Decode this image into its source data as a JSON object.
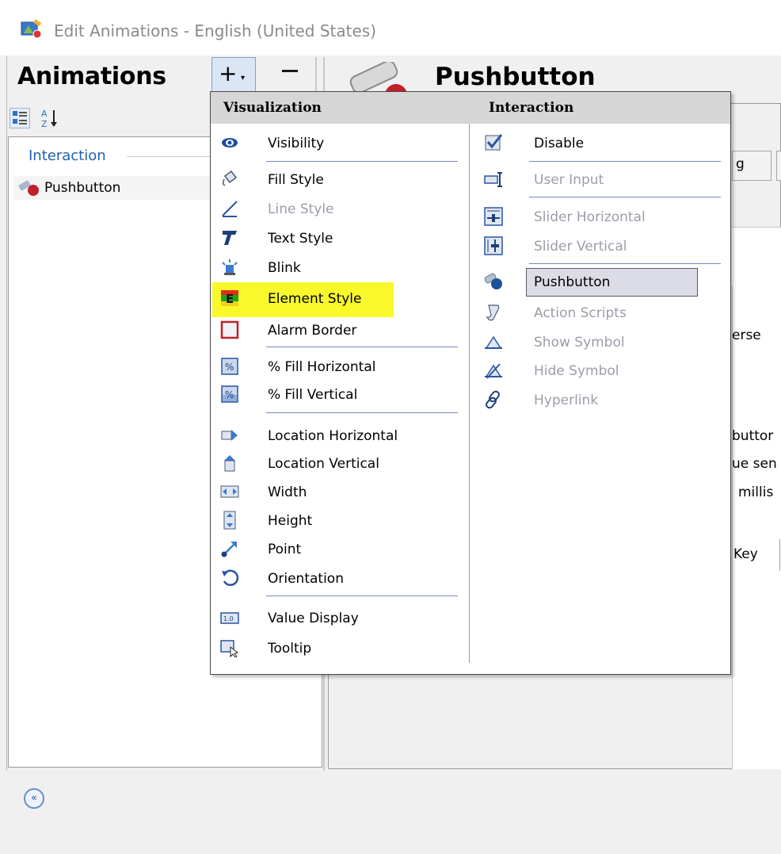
{
  "window": {
    "title": "Edit Animations - English (United States)"
  },
  "left_panel": {
    "title": "Animations",
    "add_label": "+",
    "remove_label": "−",
    "sort_label": "A Z",
    "group_label": "Interaction",
    "items": [
      {
        "label": "Pushbutton"
      }
    ]
  },
  "right_panel": {
    "title": "Pushbutton",
    "tab_partial": "g",
    "fragments": {
      "erse": "erse",
      "buttor": "buttor",
      "uesen": "ue sen",
      "millis": "millis",
      "key": "Key"
    }
  },
  "menu": {
    "visualization": {
      "header": "Visualization",
      "items": [
        {
          "label": "Visibility",
          "icon": "eye-icon",
          "enabled": true
        },
        {
          "label": "Fill Style",
          "icon": "paint-bucket-icon",
          "enabled": true
        },
        {
          "label": "Line Style",
          "icon": "pen-line-icon",
          "enabled": false
        },
        {
          "label": "Text Style",
          "icon": "text-style-icon",
          "enabled": true
        },
        {
          "label": "Blink",
          "icon": "blink-light-icon",
          "enabled": true
        },
        {
          "label": "Element Style",
          "icon": "element-style-icon",
          "enabled": true,
          "highlighted": true
        },
        {
          "label": "Alarm Border",
          "icon": "alarm-border-icon",
          "enabled": true
        },
        {
          "label": "% Fill Horizontal",
          "icon": "fill-horizontal-icon",
          "enabled": true
        },
        {
          "label": "% Fill Vertical",
          "icon": "fill-vertical-icon",
          "enabled": true
        },
        {
          "label": "Location Horizontal",
          "icon": "location-horizontal-icon",
          "enabled": true
        },
        {
          "label": "Location Vertical",
          "icon": "location-vertical-icon",
          "enabled": true
        },
        {
          "label": "Width",
          "icon": "width-icon",
          "enabled": true
        },
        {
          "label": "Height",
          "icon": "height-icon",
          "enabled": true
        },
        {
          "label": "Point",
          "icon": "point-icon",
          "enabled": true
        },
        {
          "label": "Orientation",
          "icon": "orientation-icon",
          "enabled": true
        },
        {
          "label": "Value Display",
          "icon": "value-display-icon",
          "enabled": true
        },
        {
          "label": "Tooltip",
          "icon": "tooltip-icon",
          "enabled": true
        }
      ]
    },
    "interaction": {
      "header": "Interaction",
      "items": [
        {
          "label": "Disable",
          "icon": "disable-check-icon",
          "enabled": true
        },
        {
          "label": "User Input",
          "icon": "user-input-icon",
          "enabled": false
        },
        {
          "label": "Slider Horizontal",
          "icon": "slider-horizontal-icon",
          "enabled": false
        },
        {
          "label": "Slider Vertical",
          "icon": "slider-vertical-icon",
          "enabled": false
        },
        {
          "label": "Pushbutton",
          "icon": "pushbutton-icon",
          "enabled": true,
          "selected": true
        },
        {
          "label": "Action Scripts",
          "icon": "action-scripts-icon",
          "enabled": false
        },
        {
          "label": "Show Symbol",
          "icon": "show-symbol-icon",
          "enabled": false
        },
        {
          "label": "Hide Symbol",
          "icon": "hide-symbol-icon",
          "enabled": false
        },
        {
          "label": "Hyperlink",
          "icon": "hyperlink-icon",
          "enabled": false
        }
      ]
    }
  },
  "colors": {
    "highlight": "#f8f82a",
    "group_label": "#1f5fb4",
    "disabled_text": "#a09aa8",
    "menu_header": "#d6d6d6"
  }
}
